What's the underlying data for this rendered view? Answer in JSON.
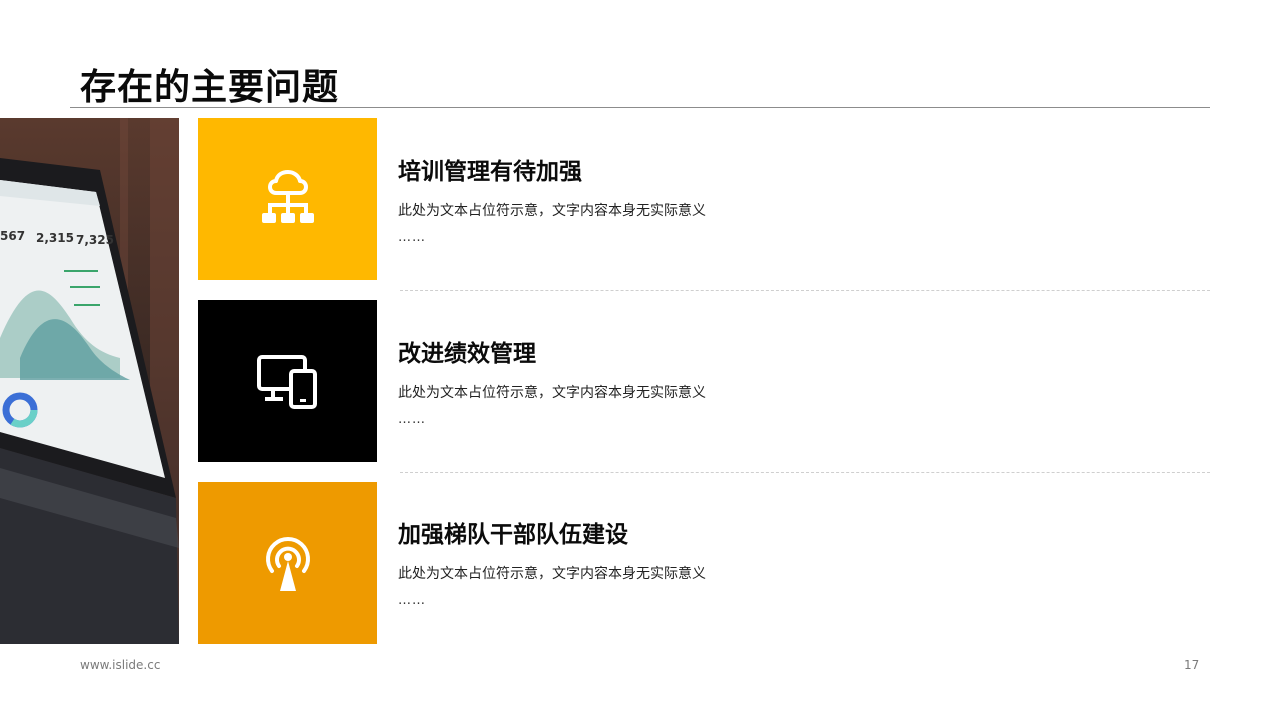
{
  "slide": {
    "title": "存在的主要问题",
    "items": [
      {
        "heading": "培训管理有待加强",
        "desc": "此处为文本占位符示意，文字内容本身无实际意义",
        "more": "……",
        "icon": "cloud-network-icon",
        "color": "#FFB800"
      },
      {
        "heading": "改进绩效管理",
        "desc": "此处为文本占位符示意，文字内容本身无实际意义",
        "more": "……",
        "icon": "devices-icon",
        "color": "#000000"
      },
      {
        "heading": "加强梯队干部队伍建设",
        "desc": "此处为文本占位符示意，文字内容本身无实际意义",
        "more": "……",
        "icon": "broadcast-icon",
        "color": "#EE9A00"
      }
    ],
    "photo": {
      "label": "laptop-dashboard-photo",
      "stats": [
        "567",
        "2,315",
        "7,325"
      ]
    }
  },
  "footer": {
    "url": "www.islide.cc",
    "page": "17"
  }
}
